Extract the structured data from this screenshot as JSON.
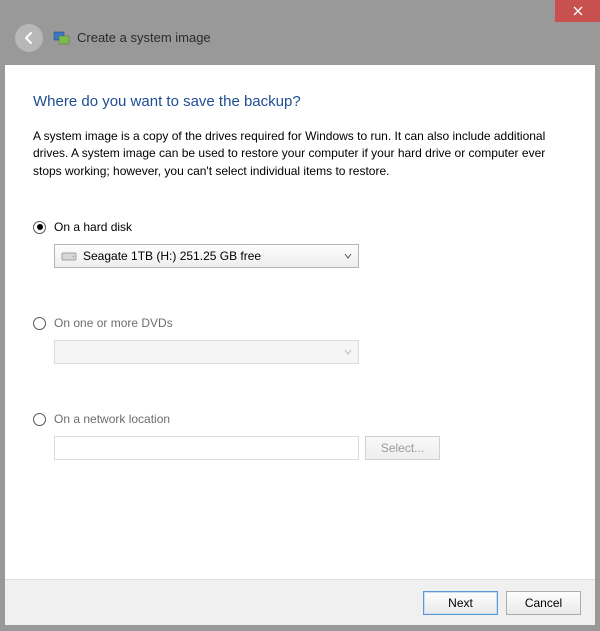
{
  "window": {
    "title": "Create a system image"
  },
  "page": {
    "heading": "Where do you want to save the backup?",
    "description": "A system image is a copy of the drives required for Windows to run. It can also include additional drives. A system image can be used to restore your computer if your hard drive or computer ever stops working; however, you can't select individual items to restore."
  },
  "options": {
    "hard_disk": {
      "label": "On a hard disk",
      "selected_value": "Seagate 1TB (H:)  251.25 GB free"
    },
    "dvds": {
      "label": "On one or more DVDs",
      "selected_value": ""
    },
    "network": {
      "label": "On a network location",
      "path": "",
      "select_btn": "Select..."
    }
  },
  "footer": {
    "next": "Next",
    "cancel": "Cancel"
  }
}
